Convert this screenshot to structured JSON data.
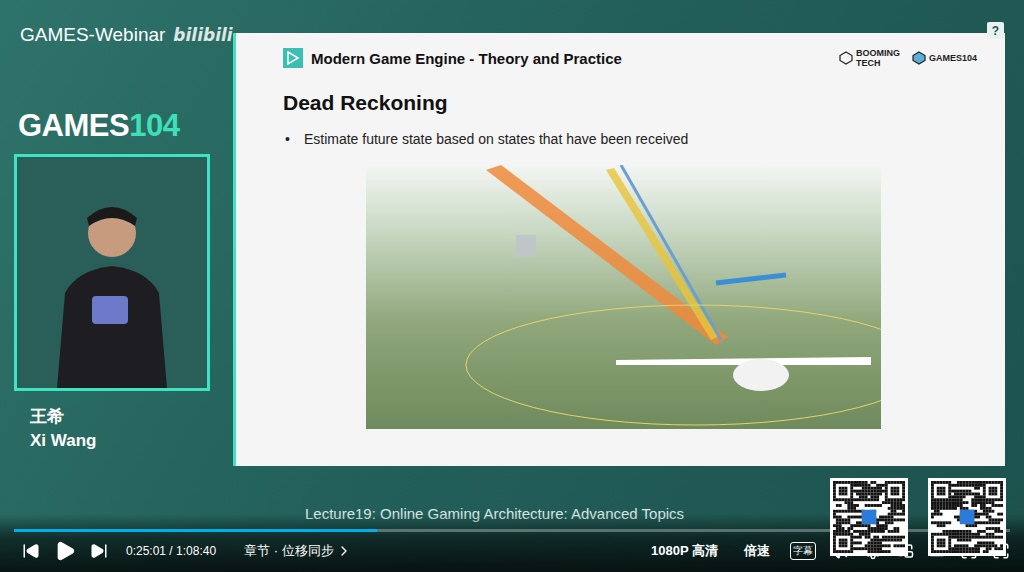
{
  "overlay": {
    "channel": "GAMES-Webinar",
    "platform": "bilibili",
    "help": "?"
  },
  "logo": {
    "text": "GAMES",
    "number": "104"
  },
  "speaker": {
    "name_cn": "王希",
    "name_en": "Xi Wang"
  },
  "slide": {
    "header": "Modern Game Engine - Theory and Practice",
    "logos": [
      {
        "lines": [
          "BOOMING",
          "TECH"
        ]
      },
      {
        "lines": [
          "GAMES104"
        ]
      }
    ],
    "title": "Dead Reckoning",
    "bullets": [
      "Estimate future state based on states that have been received"
    ]
  },
  "lecture": "Lecture19: Online Gaming Architecture: Advanced Topics",
  "player": {
    "playing": false,
    "progress": {
      "level": 0.364
    },
    "time": "0:25:01 / 1:08:40",
    "chapter": "章节 · 位移同步",
    "quality": "1080P 高清",
    "speed": "倍速",
    "subtitle": "字幕"
  }
}
